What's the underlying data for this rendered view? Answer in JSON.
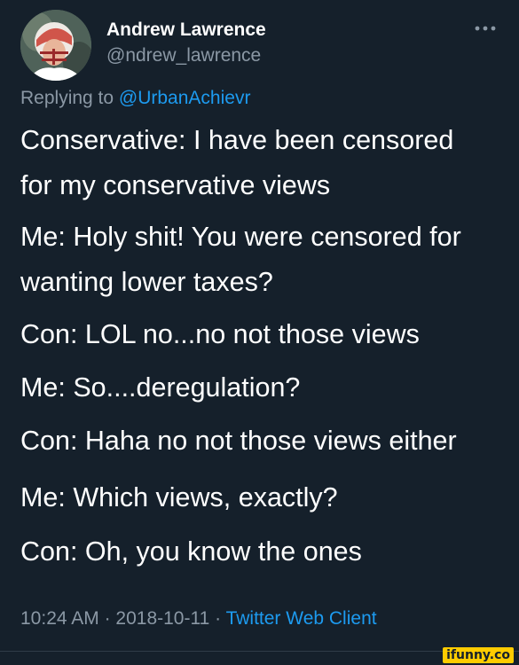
{
  "author": {
    "display_name": "Andrew Lawrence",
    "handle": "@ndrew_lawrence"
  },
  "reply": {
    "prefix": "Replying to ",
    "mention": "@UrbanAchievr"
  },
  "body_lines": [
    "Conservative: I have been censored",
    "for my conservative views",
    "Me: Holy shit! You were censored for",
    "wanting lower taxes?",
    "Con: LOL no...no not those views",
    "Me: So....deregulation?",
    "Con: Haha no not those views either",
    "Me: Which views, exactly?",
    "Con: Oh, you know the ones"
  ],
  "meta": {
    "time": "10:24 AM",
    "separator": " · ",
    "date": "2018-10-11",
    "source": "Twitter Web Client"
  },
  "icons": {
    "more": "more-horizontal-icon"
  },
  "watermark": "ifunny.co",
  "colors": {
    "background": "#15202b",
    "primary_text": "#ffffff",
    "secondary_text": "#8b98a5",
    "accent": "#1d9bf0"
  }
}
